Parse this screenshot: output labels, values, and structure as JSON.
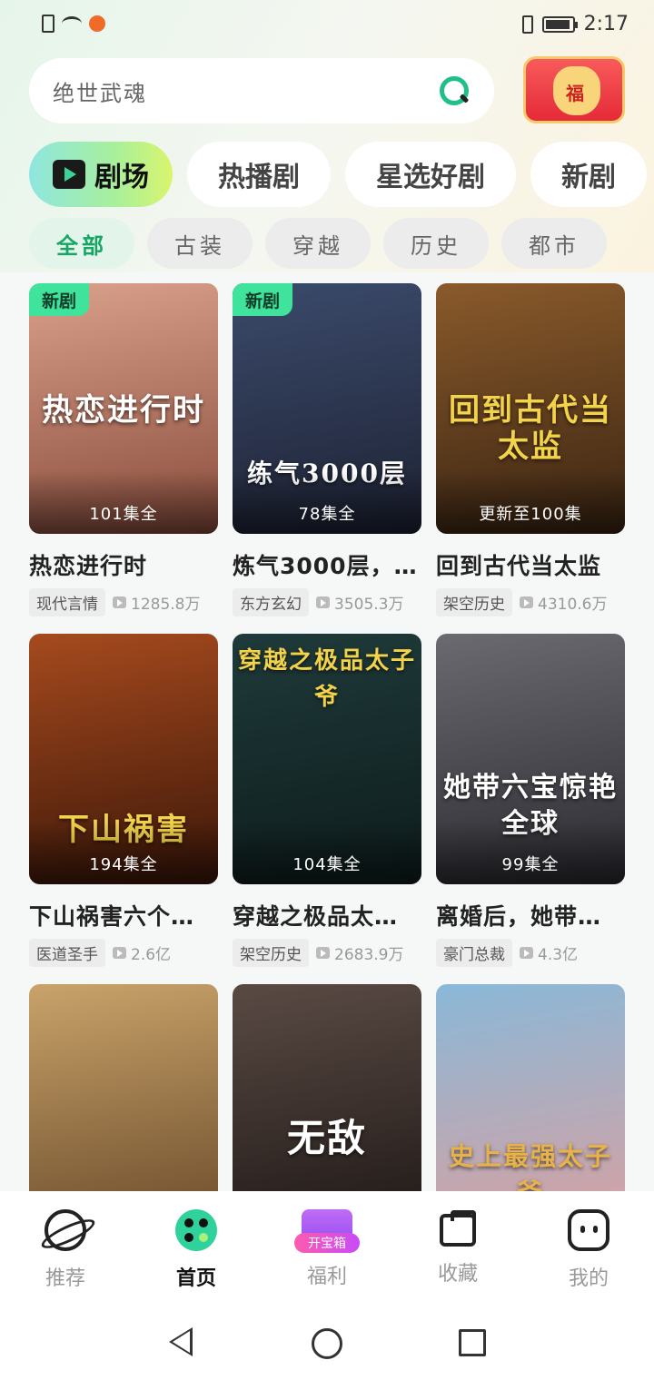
{
  "status_bar": {
    "time": "2:17"
  },
  "search": {
    "placeholder": "绝世武魂"
  },
  "tabs": [
    {
      "label": "剧场"
    },
    {
      "label": "热播剧"
    },
    {
      "label": "星选好剧"
    },
    {
      "label": "新剧"
    }
  ],
  "genres": [
    "全部",
    "古装",
    "穿越",
    "历史",
    "都市"
  ],
  "dramas": [
    {
      "title": "热恋进行时",
      "episodes": "101集全",
      "genre": "现代言情",
      "views": "1285.8万",
      "badge": "新剧",
      "art_text": "热恋进行时",
      "colors": [
        "#d9a08a",
        "#8a4c3c"
      ]
    },
    {
      "title": "炼气3000层，…",
      "episodes": "78集全",
      "genre": "东方玄幻",
      "views": "3505.3万",
      "badge": "新剧",
      "art_text": "练气3000层",
      "colors": [
        "#3b4a6b",
        "#1d2233"
      ]
    },
    {
      "title": "回到古代当太监",
      "episodes": "更新至100集",
      "genre": "架空历史",
      "views": "4310.6万",
      "badge": "",
      "art_text": "回到古代当太监",
      "colors": [
        "#8a5a2b",
        "#3a2412"
      ]
    },
    {
      "title": "下山祸害六个…",
      "episodes": "194集全",
      "genre": "医道圣手",
      "views": "2.6亿",
      "badge": "",
      "art_text": "下山祸害",
      "colors": [
        "#a64a1e",
        "#3b1608"
      ]
    },
    {
      "title": "穿越之极品太…",
      "episodes": "104集全",
      "genre": "架空历史",
      "views": "2683.9万",
      "badge": "",
      "art_text": "穿越之极品太子爷",
      "colors": [
        "#1f3a3a",
        "#0e1c1c"
      ]
    },
    {
      "title": "离婚后，她带…",
      "episodes": "99集全",
      "genre": "豪门总裁",
      "views": "4.3亿",
      "badge": "",
      "art_text": "她带六宝惊艳全球",
      "colors": [
        "#6a6a70",
        "#2a2a30"
      ]
    },
    {
      "title": "",
      "episodes": "",
      "genre": "",
      "views": "",
      "badge": "",
      "art_text": "",
      "colors": [
        "#c9a36a",
        "#6a4a2a"
      ]
    },
    {
      "title": "",
      "episodes": "",
      "genre": "",
      "views": "",
      "badge": "",
      "art_text": "无敌",
      "colors": [
        "#5a4a44",
        "#1e1816"
      ]
    },
    {
      "title": "",
      "episodes": "",
      "genre": "",
      "views": "",
      "badge": "",
      "art_text": "史上最强太子爷",
      "colors": [
        "#8ab8d8",
        "#d9a0a0"
      ]
    }
  ],
  "bottom_nav": [
    {
      "label": "推荐",
      "icon": "planet-icon"
    },
    {
      "label": "首页",
      "icon": "film-reel-icon"
    },
    {
      "label": "福利",
      "icon": "treasure-chest-icon",
      "pill": "开宝箱"
    },
    {
      "label": "收藏",
      "icon": "folder-icon"
    },
    {
      "label": "我的",
      "icon": "face-icon"
    }
  ],
  "colors": {
    "accent": "#1fbf8a",
    "badge": "#3fe39c"
  }
}
